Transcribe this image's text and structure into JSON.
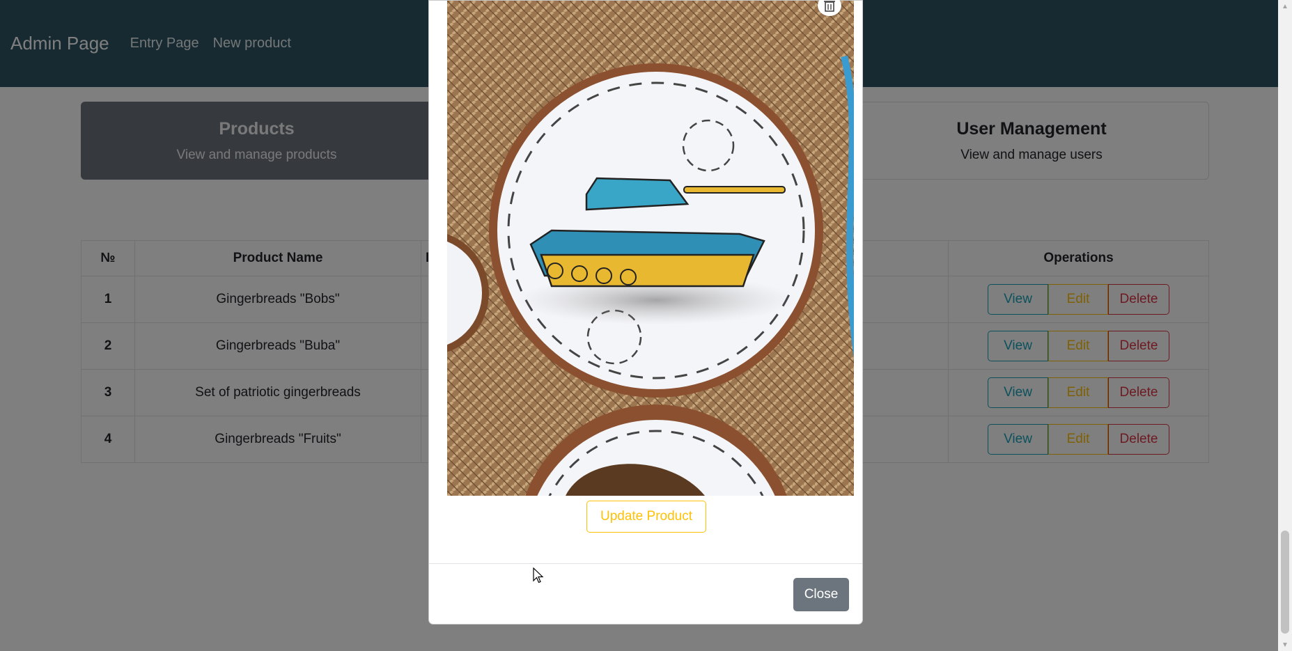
{
  "navbar": {
    "brand": "Admin Page",
    "links": [
      "Entry Page",
      "New product"
    ]
  },
  "cards": [
    {
      "title": "Products",
      "subtitle": "View and manage products"
    },
    {
      "title": "User Management",
      "subtitle": "View and manage users"
    }
  ],
  "table": {
    "headers": [
      "№",
      "Product Name",
      "P",
      "",
      "Operations"
    ],
    "rows": [
      {
        "num": "1",
        "name": "Gingerbreads \"Bobs\"",
        "partial": ""
      },
      {
        "num": "2",
        "name": "Gingerbreads \"Buba\"",
        "partial": ""
      },
      {
        "num": "3",
        "name": "Set of patriotic gingerbreads",
        "partial": ""
      },
      {
        "num": "4",
        "name": "Gingerbreads \"Fruits\"",
        "partial": ""
      }
    ],
    "ops": {
      "view": "View",
      "edit": "Edit",
      "delete": "Delete"
    }
  },
  "modal": {
    "update_label": "Update Product",
    "close_label": "Close",
    "image_icon": "tank-cookie-image",
    "trash_icon": "trash-icon"
  },
  "colors": {
    "navbar": "#2f5563",
    "info": "#17a2b8",
    "warning": "#ffc107",
    "danger": "#dc3545",
    "secondary": "#6c757d"
  }
}
